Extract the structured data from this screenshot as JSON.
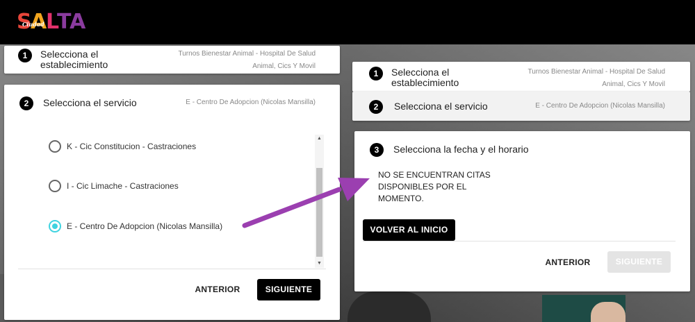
{
  "header": {
    "logo_big": "SALTA",
    "logo_script": "Ciudad"
  },
  "left": {
    "step1": {
      "number": "1",
      "title": "Selecciona el establecimiento",
      "subtitle": "Turnos Bienestar Animal - Hospital De Salud Animal, Cics Y Movil"
    },
    "step2": {
      "number": "2",
      "title": "Selecciona el servicio",
      "subtitle": "E - Centro De Adopcion (Nicolas Mansilla)"
    },
    "options": [
      {
        "label": "K - Cic Constitucion - Castraciones",
        "checked": false
      },
      {
        "label": "I - Cic Limache - Castraciones",
        "checked": false
      },
      {
        "label": "E - Centro De Adopcion (Nicolas Mansilla)",
        "checked": true
      }
    ],
    "btn_prev": "ANTERIOR",
    "btn_next": "SIGUIENTE"
  },
  "right": {
    "step1": {
      "number": "1",
      "title": "Selecciona el establecimiento",
      "subtitle": "Turnos Bienestar Animal - Hospital De Salud Animal, Cics Y Movil"
    },
    "step2": {
      "number": "2",
      "title": "Selecciona el servicio",
      "subtitle": "E - Centro De Adopcion (Nicolas Mansilla)"
    },
    "step3": {
      "number": "3",
      "title": "Selecciona la fecha y el horario"
    },
    "message": "NO SE ENCUENTRAN CITAS DISPONIBLES POR EL MOMENTO.",
    "btn_home": "VOLVER AL INICIO",
    "btn_prev": "ANTERIOR",
    "btn_next": "SIGUIENTE"
  },
  "colors": {
    "radio_accent": "#3fd3e0",
    "arrow": "#9b3fb0",
    "logo": [
      "#e8463a",
      "#f2a51e",
      "#e2316b",
      "#8a3b9e"
    ]
  }
}
